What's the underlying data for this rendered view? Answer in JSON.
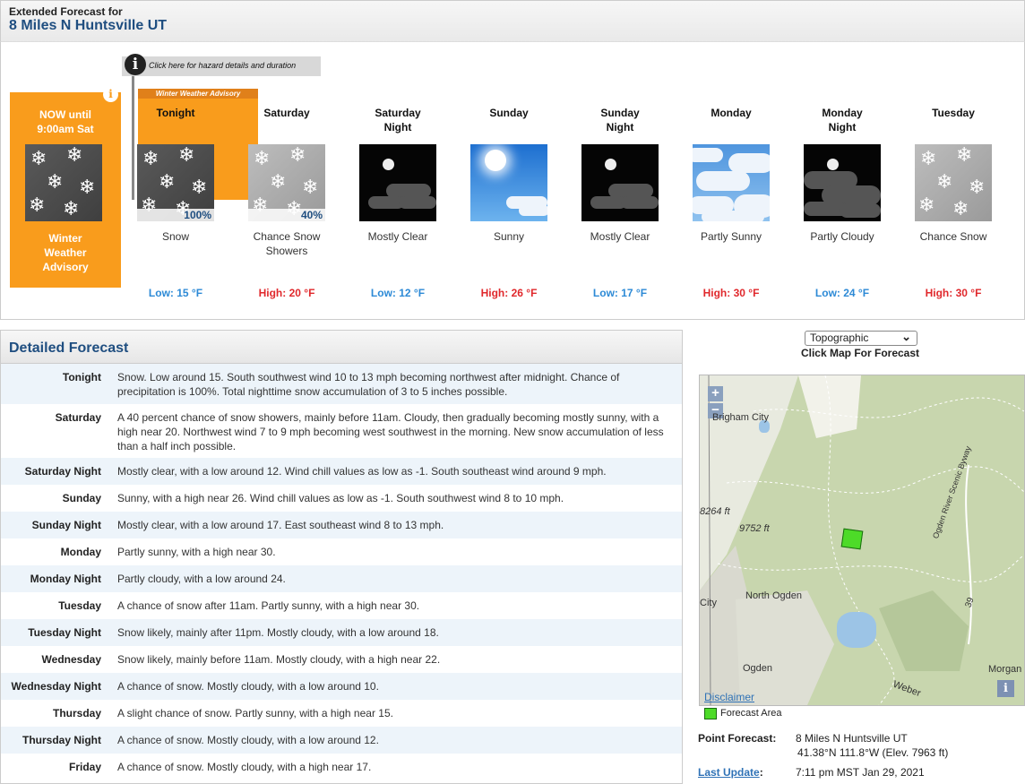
{
  "header": {
    "line1": "Extended Forecast for",
    "location": "8 Miles N Huntsville UT"
  },
  "hazard": {
    "tooltip": "Click here for hazard details and duration",
    "info_icon": "info-icon"
  },
  "now": {
    "title": "NOW until\n9:00am Sat",
    "label": "Winter\nWeather\nAdvisory",
    "icon": "snow-icon"
  },
  "advisory_banner": "Winter Weather Advisory",
  "periods": [
    {
      "name": "Tonight",
      "desc": "Snow",
      "temp": "Low: 15 °F",
      "kind": "low",
      "pop": "100%",
      "icon": "snow-icon"
    },
    {
      "name": "Saturday",
      "desc": "Chance Snow\nShowers",
      "temp": "High: 20 °F",
      "kind": "high",
      "pop": "40%",
      "icon": "snow-showers-icon"
    },
    {
      "name": "Saturday\nNight",
      "desc": "Mostly Clear",
      "temp": "Low: 12 °F",
      "kind": "low",
      "pop": "",
      "icon": "night-clear-icon"
    },
    {
      "name": "Sunday",
      "desc": "Sunny",
      "temp": "High: 26 °F",
      "kind": "high",
      "pop": "",
      "icon": "sunny-icon"
    },
    {
      "name": "Sunday\nNight",
      "desc": "Mostly Clear",
      "temp": "Low: 17 °F",
      "kind": "low",
      "pop": "",
      "icon": "night-clear-icon"
    },
    {
      "name": "Monday",
      "desc": "Partly Sunny",
      "temp": "High: 30 °F",
      "kind": "high",
      "pop": "",
      "icon": "partly-sunny-icon"
    },
    {
      "name": "Monday\nNight",
      "desc": "Partly Cloudy",
      "temp": "Low: 24 °F",
      "kind": "low",
      "pop": "",
      "icon": "night-partly-cloudy-icon"
    },
    {
      "name": "Tuesday",
      "desc": "Chance Snow",
      "temp": "High: 30 °F",
      "kind": "high",
      "pop": "",
      "icon": "chance-snow-icon"
    }
  ],
  "detailed": {
    "title": "Detailed Forecast",
    "rows": [
      {
        "label": "Tonight",
        "text": "Snow. Low around 15. South southwest wind 10 to 13 mph becoming northwest after midnight. Chance of precipitation is 100%. Total nighttime snow accumulation of 3 to 5 inches possible."
      },
      {
        "label": "Saturday",
        "text": "A 40 percent chance of snow showers, mainly before 11am. Cloudy, then gradually becoming mostly sunny, with a high near 20. Northwest wind 7 to 9 mph becoming west southwest in the morning. New snow accumulation of less than a half inch possible."
      },
      {
        "label": "Saturday Night",
        "text": "Mostly clear, with a low around 12. Wind chill values as low as -1. South southeast wind around 9 mph."
      },
      {
        "label": "Sunday",
        "text": "Sunny, with a high near 26. Wind chill values as low as -1. South southwest wind 8 to 10 mph."
      },
      {
        "label": "Sunday Night",
        "text": "Mostly clear, with a low around 17. East southeast wind 8 to 13 mph."
      },
      {
        "label": "Monday",
        "text": "Partly sunny, with a high near 30."
      },
      {
        "label": "Monday Night",
        "text": "Partly cloudy, with a low around 24."
      },
      {
        "label": "Tuesday",
        "text": "A chance of snow after 11am. Partly sunny, with a high near 30."
      },
      {
        "label": "Tuesday Night",
        "text": "Snow likely, mainly after 11pm. Mostly cloudy, with a low around 18."
      },
      {
        "label": "Wednesday",
        "text": "Snow likely, mainly before 11am. Mostly cloudy, with a high near 22."
      },
      {
        "label": "Wednesday Night",
        "text": "A chance of snow. Mostly cloudy, with a low around 10."
      },
      {
        "label": "Thursday",
        "text": "A slight chance of snow. Partly sunny, with a high near 15."
      },
      {
        "label": "Thursday Night",
        "text": "A chance of snow. Mostly cloudy, with a low around 12."
      },
      {
        "label": "Friday",
        "text": "A chance of snow. Mostly cloudy, with a high near 17."
      }
    ]
  },
  "map": {
    "select_value": "Topographic",
    "click_label": "Click Map For Forecast",
    "zoom_in": "+",
    "zoom_out": "−",
    "labels": {
      "brigham": "Brigham City",
      "e8264": "8264 ft",
      "e9752": "9752 ft",
      "north_ogden": "North Ogden",
      "city": "City",
      "ogden": "Ogden",
      "morgan": "Morgan",
      "weber": "Weber",
      "ogden_river": "Ogden River Scenic Byway",
      "route39": "39"
    },
    "disclaimer": "Disclaimer",
    "legend": "Forecast Area"
  },
  "point": {
    "label": "Point Forecast:",
    "place": "8 Miles N Huntsville UT",
    "coords": "41.38°N 111.8°W (Elev. 7963 ft)",
    "update_label": "Last Update",
    "update_colon": ":",
    "update_value": "7:11 pm MST Jan 29, 2021"
  }
}
